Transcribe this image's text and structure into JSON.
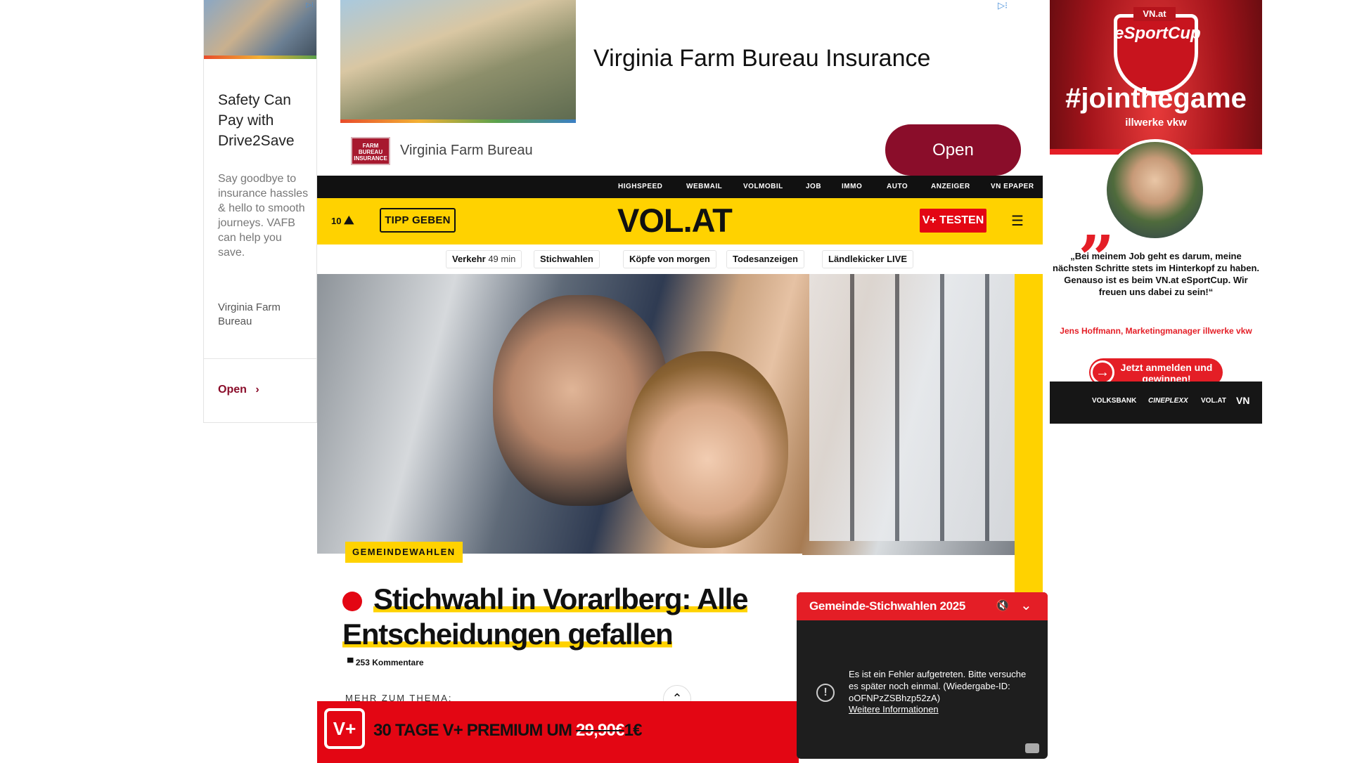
{
  "left_ad": {
    "adchoices": "▷⁝",
    "headline": "Safety Can Pay with Drive2Save",
    "body": "Say goodbye to insurance hassles & hello to smooth journeys. VAFB can help you save.",
    "advertiser": "Virginia Farm Bureau",
    "open_label": "Open",
    "open_chevron": "›"
  },
  "top_ad": {
    "title": "Virginia Farm Bureau Insurance",
    "logo_text": "FARM BUREAU INSURANCE",
    "brand": "Virginia Farm Bureau",
    "open_label": "Open",
    "adchoices": "▷⁝"
  },
  "right_ad": {
    "badge": "VN.at",
    "shield_title": "eSportCup",
    "hashtag": "#jointhegame",
    "sponsor": "illwerke vkw",
    "quote_mark": "„",
    "quote": "„Bei meinem Job geht es darum, meine nächsten Schritte stets im Hinterkopf zu haben. Genauso ist es beim VN.at eSportCup. Wir freuen uns dabei zu sein!“",
    "author": "Jens Hoffmann, Marketingmanager illwerke vkw",
    "cta": "Jetzt anmelden und gewinnen!",
    "logos": [
      "VOLKSBANK",
      "CINEPLEXX",
      "VOL.AT",
      "VN"
    ]
  },
  "top_nav": {
    "items": [
      "HIGHSPEED",
      "WEBMAIL",
      "VOLMOBIL",
      "JOB",
      "IMMO",
      "AUTO",
      "ANZEIGER",
      "VN EPAPER"
    ]
  },
  "header": {
    "weather_value": "10",
    "weather_icon": "⛰",
    "tipp_label": "TIPP GEBEN",
    "logo": "VOL.AT",
    "vplus_label": "V+ TESTEN",
    "menu_icon": "☰"
  },
  "sub_nav": {
    "traffic_label": "Verkehr",
    "traffic_value": "49 min",
    "items": [
      "Stichwahlen",
      "Köpfe von morgen",
      "Todesanzeigen",
      "Ländlekicker LIVE"
    ]
  },
  "article": {
    "tag": "GEMEINDEWAHLEN",
    "headline_line1": "Stichwahl in Vorarlberg: Alle",
    "headline_line2": "Entscheidungen gefallen",
    "comments": "253 Kommentare",
    "more": "MEHR ZUM THEMA:"
  },
  "premium": {
    "badge": "V+",
    "text_prefix": "30 TAGE V+ PREMIUM UM ",
    "old_price": "29,90€",
    "new_price": "1€"
  },
  "video": {
    "title": "Gemeinde-Stichwahlen 2025",
    "error_message": "Es ist ein Fehler aufgetreten. Bitte versuche es später noch einmal. (Wiedergabe-ID: oOFNPzZSBhzp52zA)",
    "error_link": "Weitere Informationen",
    "mute_icon": "🔇",
    "chevron_icon": "⌄"
  },
  "colors": {
    "brand_yellow": "#ffd200",
    "brand_red": "#e30613",
    "ad_maroon": "#8a0d2a"
  }
}
